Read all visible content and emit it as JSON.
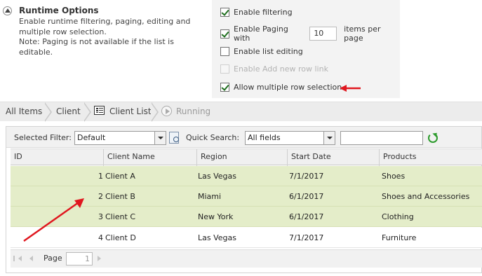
{
  "runtime": {
    "title": "Runtime Options",
    "desc_line1": "Enable runtime filtering, paging, editing and",
    "desc_line2": "multiple row selection.",
    "desc_line3": "Note: Paging is not available if the list is editable.",
    "options": {
      "filtering": {
        "label": "Enable filtering",
        "checked": true
      },
      "paging": {
        "label": "Enable Paging with",
        "checked": true,
        "value": "10",
        "suffix": "items per page"
      },
      "editing": {
        "label": "Enable list editing",
        "checked": false
      },
      "add_row": {
        "label": "Enable Add new row link",
        "checked": false,
        "disabled": true
      },
      "multi_select": {
        "label": "Allow multiple row selection",
        "checked": true
      }
    }
  },
  "breadcrumb": {
    "all_items": "All Items",
    "client": "Client",
    "client_list": "Client List",
    "running": "Running"
  },
  "toolbar": {
    "filter_label": "Selected Filter:",
    "filter_value": "Default",
    "search_label": "Quick Search:",
    "search_scope": "All fields",
    "search_value": ""
  },
  "table": {
    "headers": [
      "ID",
      "Client Name",
      "Region",
      "Start Date",
      "Products"
    ],
    "rows": [
      [
        "1",
        "Client A",
        "Las Vegas",
        "7/1/2017",
        "Shoes"
      ],
      [
        "2",
        "Client B",
        "Miami",
        "6/1/2017",
        "Shoes and Accessories"
      ],
      [
        "3",
        "Client C",
        "New York",
        "6/1/2017",
        "Clothing"
      ],
      [
        "4",
        "Client D",
        "Las Vegas",
        "7/1/2017",
        "Furniture"
      ]
    ]
  },
  "pager": {
    "label": "Page",
    "value": "1"
  },
  "colors": {
    "selected_row": "#e4edc9",
    "arrow": "#e0171f",
    "refresh": "#2d9b2d"
  }
}
